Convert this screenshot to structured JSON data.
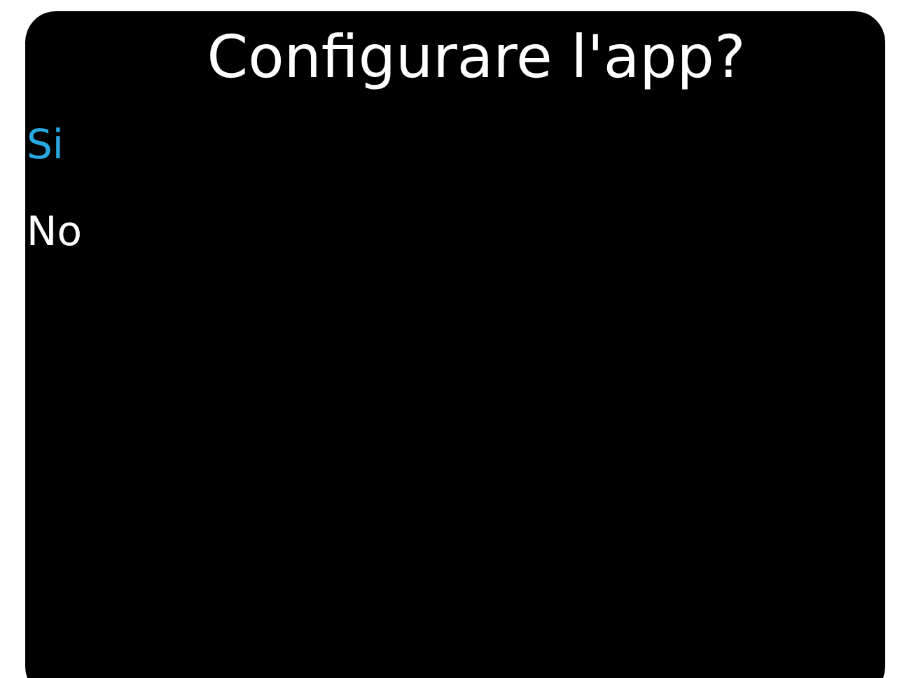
{
  "title": "Configurare l'app?",
  "options": [
    {
      "label": "Si",
      "selected": true
    },
    {
      "label": "No",
      "selected": false
    }
  ]
}
